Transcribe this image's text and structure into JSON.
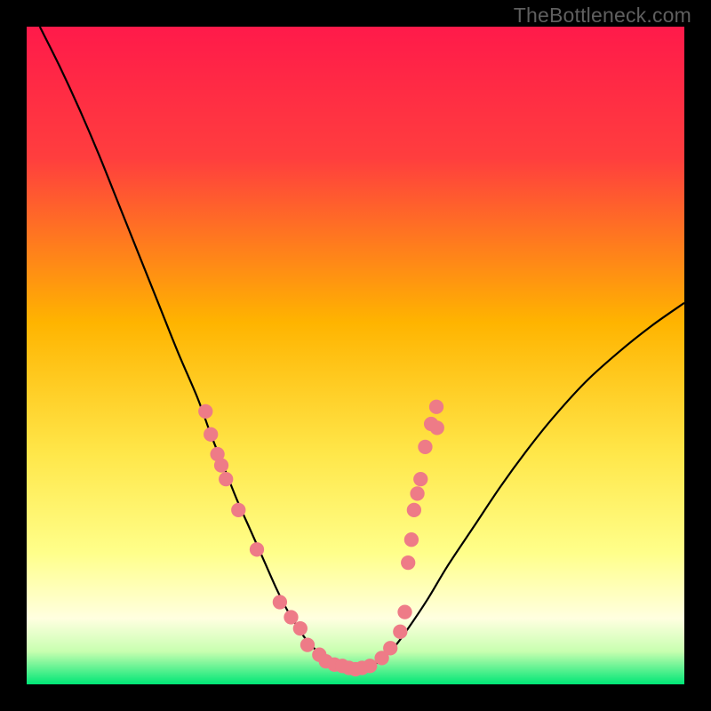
{
  "watermark": "TheBottleneck.com",
  "chart_data": {
    "type": "line",
    "title": "",
    "xlabel": "",
    "ylabel": "",
    "xlim": [
      0,
      100
    ],
    "ylim": [
      0,
      100
    ],
    "background_gradient": {
      "stops": [
        {
          "pos": 0.0,
          "color": "#ff1a4a"
        },
        {
          "pos": 0.2,
          "color": "#ff3e3e"
        },
        {
          "pos": 0.45,
          "color": "#ffb400"
        },
        {
          "pos": 0.65,
          "color": "#ffe74a"
        },
        {
          "pos": 0.8,
          "color": "#ffff8a"
        },
        {
          "pos": 0.9,
          "color": "#ffffe0"
        },
        {
          "pos": 0.95,
          "color": "#c8ffb0"
        },
        {
          "pos": 1.0,
          "color": "#00e676"
        }
      ]
    },
    "series": [
      {
        "name": "bottleneck-curve",
        "color": "#000000",
        "x": [
          2,
          5,
          8,
          11,
          14,
          17,
          20,
          23,
          26,
          28,
          30,
          32,
          34,
          36,
          38,
          39.5,
          41,
          42.5,
          44,
          46,
          48,
          50,
          52,
          54,
          56,
          58,
          61,
          64,
          68,
          72,
          76,
          80,
          85,
          90,
          95,
          100
        ],
        "y": [
          100,
          94,
          87.5,
          80.5,
          73,
          65.5,
          58,
          50.5,
          43.5,
          38,
          33,
          28,
          23.5,
          19,
          14.5,
          11.5,
          9,
          6.8,
          5.2,
          3.7,
          2.7,
          2.3,
          2.6,
          3.8,
          5.8,
          8.5,
          13,
          18,
          24,
          30,
          35.5,
          40.5,
          46,
          50.5,
          54.5,
          58
        ]
      }
    ],
    "scatter_points": {
      "name": "measured-points",
      "color": "#ee7b87",
      "radius": 1.1,
      "points": [
        {
          "x": 27.2,
          "y": 41.5
        },
        {
          "x": 28.0,
          "y": 38.0
        },
        {
          "x": 29.0,
          "y": 35.0
        },
        {
          "x": 29.6,
          "y": 33.3
        },
        {
          "x": 30.3,
          "y": 31.2
        },
        {
          "x": 32.2,
          "y": 26.5
        },
        {
          "x": 35.0,
          "y": 20.5
        },
        {
          "x": 38.5,
          "y": 12.5
        },
        {
          "x": 40.2,
          "y": 10.2
        },
        {
          "x": 41.6,
          "y": 8.5
        },
        {
          "x": 42.7,
          "y": 6.0
        },
        {
          "x": 44.5,
          "y": 4.5
        },
        {
          "x": 45.5,
          "y": 3.5
        },
        {
          "x": 46.8,
          "y": 3.0
        },
        {
          "x": 48.0,
          "y": 2.8
        },
        {
          "x": 49.0,
          "y": 2.5
        },
        {
          "x": 50.0,
          "y": 2.3
        },
        {
          "x": 51.0,
          "y": 2.5
        },
        {
          "x": 52.2,
          "y": 2.8
        },
        {
          "x": 54.0,
          "y": 4.0
        },
        {
          "x": 55.3,
          "y": 5.5
        },
        {
          "x": 56.8,
          "y": 8.0
        },
        {
          "x": 57.5,
          "y": 11.0
        },
        {
          "x": 58.0,
          "y": 18.5
        },
        {
          "x": 58.5,
          "y": 22.0
        },
        {
          "x": 58.9,
          "y": 26.5
        },
        {
          "x": 59.4,
          "y": 29.0
        },
        {
          "x": 59.9,
          "y": 31.2
        },
        {
          "x": 60.6,
          "y": 36.1
        },
        {
          "x": 61.5,
          "y": 39.6
        },
        {
          "x": 62.3,
          "y": 42.2
        },
        {
          "x": 62.4,
          "y": 39.0
        }
      ]
    }
  }
}
